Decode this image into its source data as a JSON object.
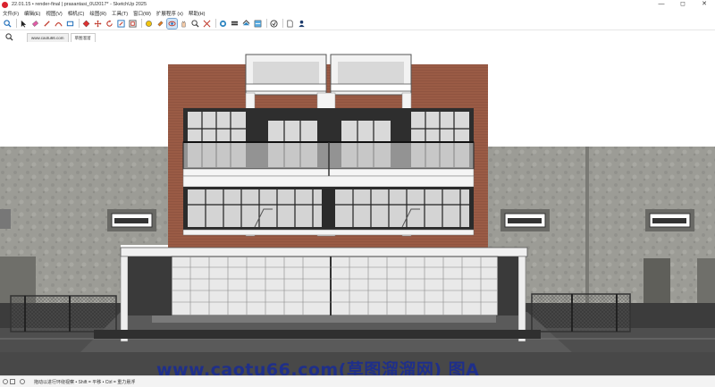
{
  "window": {
    "title": "22.01.15 • render-final | prasantasi_0U2017* - SketchUp 2025",
    "controls": [
      "—",
      "◻",
      "✕"
    ]
  },
  "menu": {
    "items": [
      "文件(F)",
      "编辑(E)",
      "视图(V)",
      "相机(C)",
      "绘图(R)",
      "工具(T)",
      "窗口(W)",
      "扩展程序 (x)",
      "帮助(H)"
    ]
  },
  "toolbar": {
    "tools": [
      "search-icon",
      "select-icon",
      "eraser-icon",
      "pencil-icon",
      "arc-icon",
      "rectangle-icon",
      "pushpull-icon",
      "move-icon",
      "rotate-icon",
      "scale-icon",
      "offset-icon",
      "tape-icon",
      "paint-icon",
      "orbit-icon",
      "pan-icon",
      "zoom-icon",
      "zoom-extents-icon",
      "section-icon",
      "component-icon",
      "materials-icon",
      "layers-icon",
      "scenes-icon",
      "document-icon",
      "user-icon"
    ],
    "active_tool": "orbit-icon"
  },
  "tabs": {
    "items": [
      "www.caotu66.com",
      "草图溜溜"
    ],
    "active": 1
  },
  "status": {
    "hint": "拖动以进行环绕视察 • Shift = 平移 • Ctrl = 重力悬浮"
  },
  "watermark": {
    "text": "www.caotu66.com(草图溜溜网) 图A"
  },
  "colors": {
    "brick": "#9a5b45",
    "concrete": "#9a9a94",
    "sky": "#ffffff",
    "road": "#4d4d4d",
    "accent": "#1f2f8a"
  }
}
